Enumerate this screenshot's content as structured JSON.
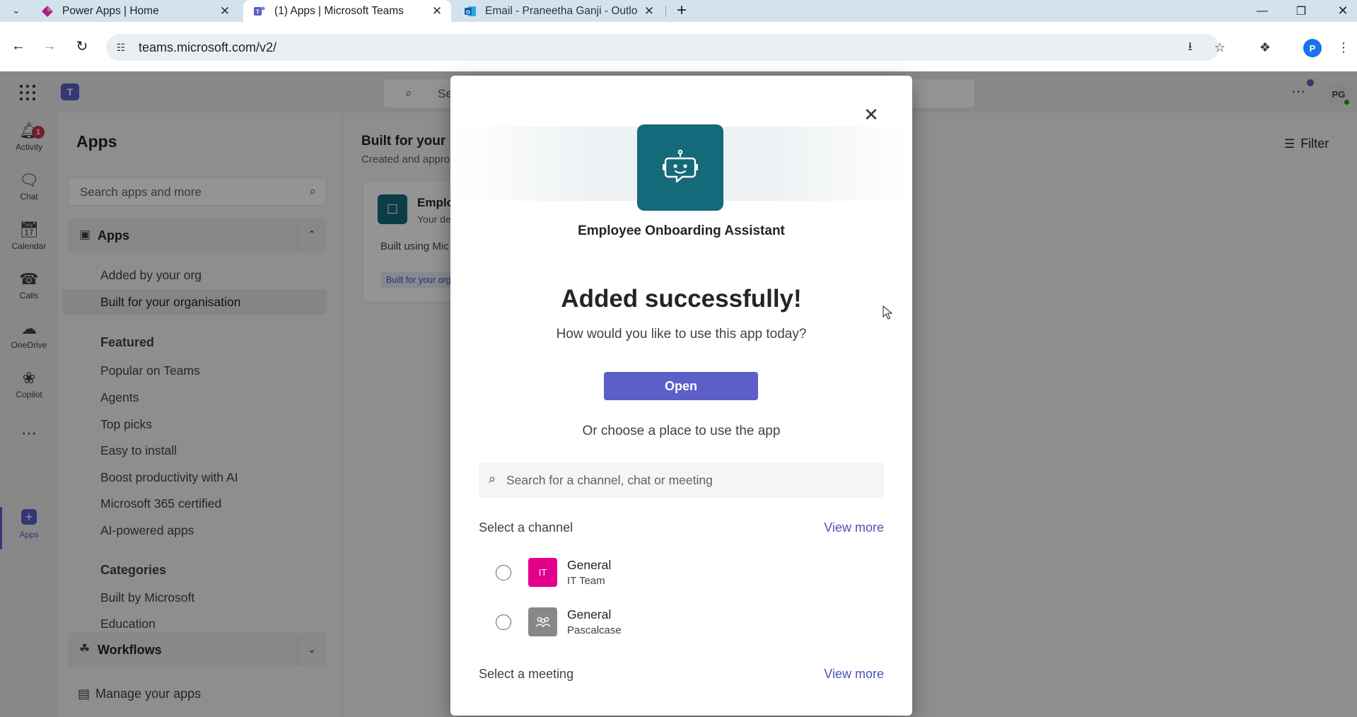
{
  "browser": {
    "tabs": [
      {
        "title": "Power Apps | Home",
        "icon": "power-apps-icon"
      },
      {
        "title": "(1) Apps | Microsoft Teams",
        "icon": "teams-icon"
      },
      {
        "title": "Email - Praneetha Ganji - Outlo",
        "icon": "outlook-icon"
      }
    ],
    "url": "teams.microsoft.com/v2/",
    "profile_initial": "P"
  },
  "teams": {
    "search_placeholder": "Se",
    "avatar_initials": "PG",
    "rail": [
      {
        "label": "Activity",
        "icon": "bell-icon",
        "badge": "1"
      },
      {
        "label": "Chat",
        "icon": "chat-icon"
      },
      {
        "label": "Calendar",
        "icon": "calendar-icon"
      },
      {
        "label": "Calls",
        "icon": "phone-icon"
      },
      {
        "label": "OneDrive",
        "icon": "cloud-icon"
      },
      {
        "label": "Copilot",
        "icon": "copilot-icon"
      },
      {
        "label": "Apps",
        "icon": "apps-icon"
      }
    ],
    "left_pane": {
      "title": "Apps",
      "search_placeholder": "Search apps and more",
      "apps_section": "Apps",
      "apps_items": [
        "Added by your org",
        "Built for your organisation"
      ],
      "featured_title": "Featured",
      "featured_items": [
        "Popular on Teams",
        "Agents",
        "Top picks",
        "Easy to install",
        "Boost productivity with AI",
        "Microsoft 365 certified",
        "AI-powered apps"
      ],
      "categories_title": "Categories",
      "categories_items": [
        "Built by Microsoft",
        "Education"
      ],
      "workflows_section": "Workflows",
      "manage": "Manage your apps"
    },
    "main": {
      "title": "Built for your",
      "subtitle": "Created and appro",
      "filter": "Filter",
      "card": {
        "name": "Emplo",
        "desc": "Your de",
        "body": "Built using Mic",
        "tag": "Built for your org"
      }
    }
  },
  "dialog": {
    "app_name": "Employee Onboarding Assistant",
    "heading": "Added successfully!",
    "subheading": "How would you like to use this app today?",
    "open_label": "Open",
    "or_text": "Or choose a place to use the app",
    "search_placeholder": "Search for a channel, chat or meeting",
    "channel_label": "Select a channel",
    "meeting_label": "Select a meeting",
    "view_more": "View more",
    "channels": [
      {
        "name": "General",
        "team": "IT Team",
        "avatar_text": "IT",
        "color": "#e3008c"
      },
      {
        "name": "General",
        "team": "Pascalcase",
        "avatar_text": "",
        "color": "#8a8886"
      }
    ]
  },
  "colors": {
    "brand": "#5b5fc7",
    "app_icon": "#146a7a",
    "link": "#4f52b2"
  }
}
